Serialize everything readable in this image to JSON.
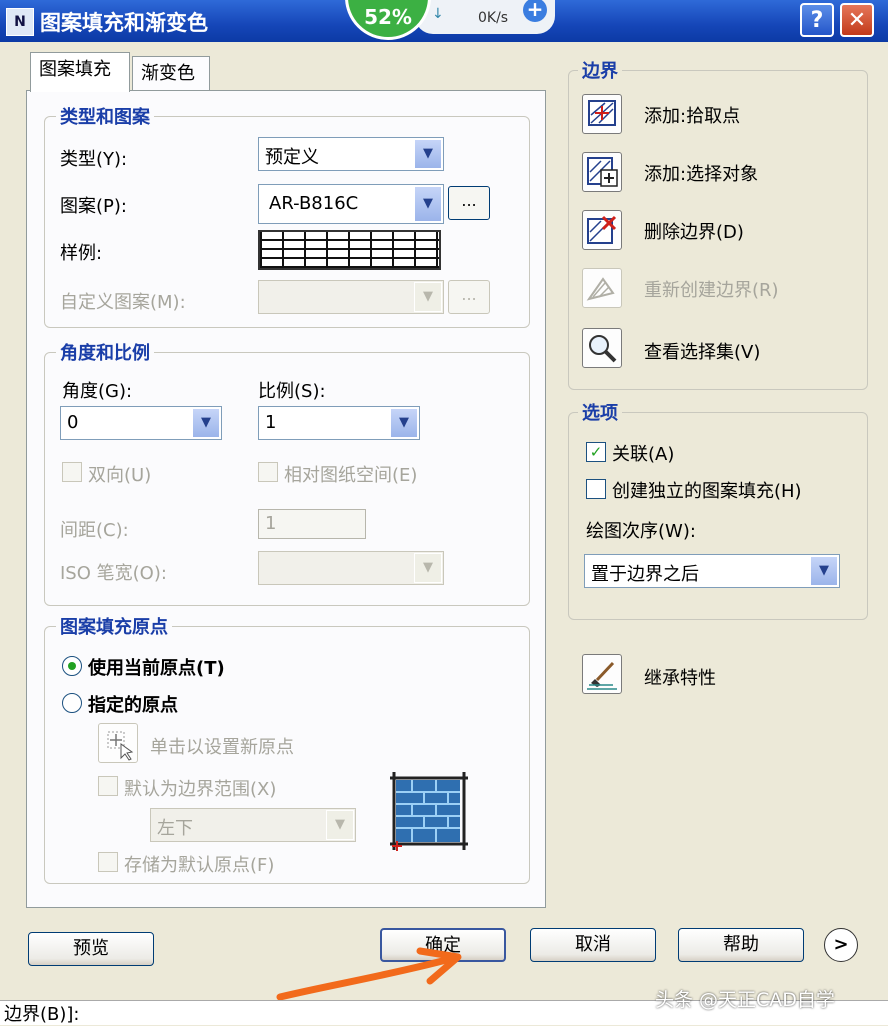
{
  "window": {
    "title": "图案填充和渐变色",
    "help": "?",
    "close": "✕",
    "app_icon": "N"
  },
  "speed_widget": {
    "percent": "52%",
    "speed": "0K/s",
    "arrow": "↓",
    "plus": "+"
  },
  "tabs": [
    {
      "label": "图案填充"
    },
    {
      "label": "渐变色"
    }
  ],
  "type_pattern": {
    "title": "类型和图案",
    "type_label": "类型(Y):",
    "type_value": "预定义",
    "pattern_label": "图案(P):",
    "pattern_value": "AR-B816C",
    "pattern_btn": "...",
    "sample_label": "样例:",
    "custom_label": "自定义图案(M):",
    "custom_btn": "..."
  },
  "angle_scale": {
    "title": "角度和比例",
    "angle_label": "角度(G):",
    "angle_value": "0",
    "scale_label": "比例(S):",
    "scale_value": "1",
    "double_label": "双向(U)",
    "relative_label": "相对图纸空间(E)",
    "spacing_label": "间距(C):",
    "spacing_value": "1",
    "iso_label": "ISO 笔宽(O):"
  },
  "origin": {
    "title": "图案填充原点",
    "use_current": "使用当前原点(T)",
    "specified": "指定的原点",
    "click_set": "单击以设置新原点",
    "default_extents": "默认为边界范围(X)",
    "position_value": "左下",
    "store_default": "存储为默认原点(F)"
  },
  "boundary": {
    "title": "边界",
    "items": [
      {
        "label": "添加:拾取点",
        "icon": "pick-points-icon"
      },
      {
        "label": "添加:选择对象",
        "icon": "select-objects-icon"
      },
      {
        "label": "删除边界(D)",
        "icon": "remove-boundary-icon"
      },
      {
        "label": "重新创建边界(R)",
        "icon": "recreate-boundary-icon"
      },
      {
        "label": "查看选择集(V)",
        "icon": "magnifier-icon"
      }
    ]
  },
  "options": {
    "title": "选项",
    "associative": "关联(A)",
    "associative_checked": true,
    "independent": "创建独立的图案填充(H)",
    "draw_order_label": "绘图次序(W):",
    "draw_order_value": "置于边界之后"
  },
  "inherit_label": "继承特性",
  "buttons": {
    "preview": "预览",
    "ok": "确定",
    "cancel": "取消",
    "help": "帮助",
    "more": ">"
  },
  "watermark": "头条 @天正CAD自学",
  "command_line": "边界(B)]:"
}
